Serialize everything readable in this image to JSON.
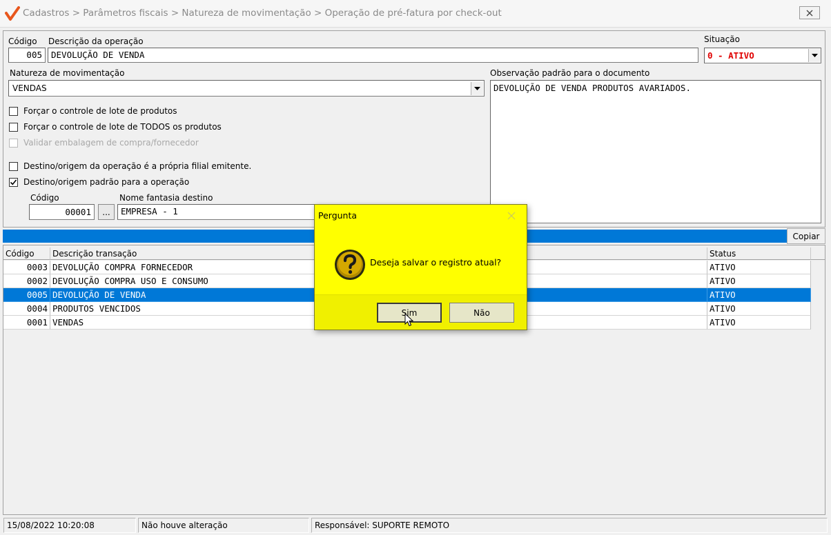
{
  "window": {
    "title": "Cadastros > Parâmetros fiscais > Natureza de movimentação > Operação de pré-fatura por check-out",
    "close_icon": "close-icon"
  },
  "form": {
    "codigo_label": "Código",
    "codigo_value": "005",
    "descricao_label": "Descrição da operação",
    "descricao_value": "DEVOLUÇÃO DE VENDA",
    "situacao_label": "Situação",
    "situacao_value": "0 - ATIVO",
    "situacao_color": "#e00000",
    "natureza_label": "Natureza de movimentação",
    "natureza_value": "VENDAS",
    "observacao_label": "Observação padrão para o documento",
    "observacao_value": "DEVOLUÇÃO DE VENDA PRODUTOS AVARIADOS.",
    "checkboxes": [
      {
        "label": "Forçar o controle de lote de produtos",
        "checked": false,
        "disabled": false
      },
      {
        "label": "Forçar o controle de lote de TODOS os produtos",
        "checked": false,
        "disabled": false
      },
      {
        "label": "Validar embalagem de compra/fornecedor",
        "checked": false,
        "disabled": true
      },
      {
        "label": "Destino/origem da operação é a própria filial emitente.",
        "checked": false,
        "disabled": false
      },
      {
        "label": "Destino/origem padrão para a operação",
        "checked": true,
        "disabled": false
      }
    ],
    "destino_codigo_label": "Código",
    "destino_codigo_value": "00001",
    "lookup_button": "...",
    "nome_fantasia_label": "Nome fantasia destino",
    "nome_fantasia_value": "EMPRESA - 1"
  },
  "toolbar": {
    "copy_label": "Copiar"
  },
  "grid": {
    "columns": [
      "Código",
      "Descrição  transação",
      "Status"
    ],
    "rows": [
      {
        "codigo": "0003",
        "descricao": "DEVOLUÇÃO COMPRA FORNECEDOR",
        "status": "ATIVO",
        "selected": false
      },
      {
        "codigo": "0002",
        "descricao": "DEVOLUÇÃO COMPRA USO E CONSUMO",
        "status": "ATIVO",
        "selected": false
      },
      {
        "codigo": "0005",
        "descricao": "DEVOLUÇÃO DE VENDA",
        "status": "ATIVO",
        "selected": true
      },
      {
        "codigo": "0004",
        "descricao": "PRODUTOS VENCIDOS",
        "status": "ATIVO",
        "selected": false
      },
      {
        "codigo": "0001",
        "descricao": "VENDAS",
        "status": "ATIVO",
        "selected": false
      }
    ],
    "selection_color": "#0078d7"
  },
  "statusbar": {
    "datetime": "15/08/2022 10:20:08",
    "change_status": "Não houve alteração",
    "responsavel": "Responsável: SUPORTE REMOTO"
  },
  "dialog": {
    "title": "Pergunta",
    "message": "Deseja salvar o registro atual?",
    "yes_label": "Sim",
    "no_label": "Não",
    "background": "#ffff00",
    "icon": "question-icon"
  }
}
